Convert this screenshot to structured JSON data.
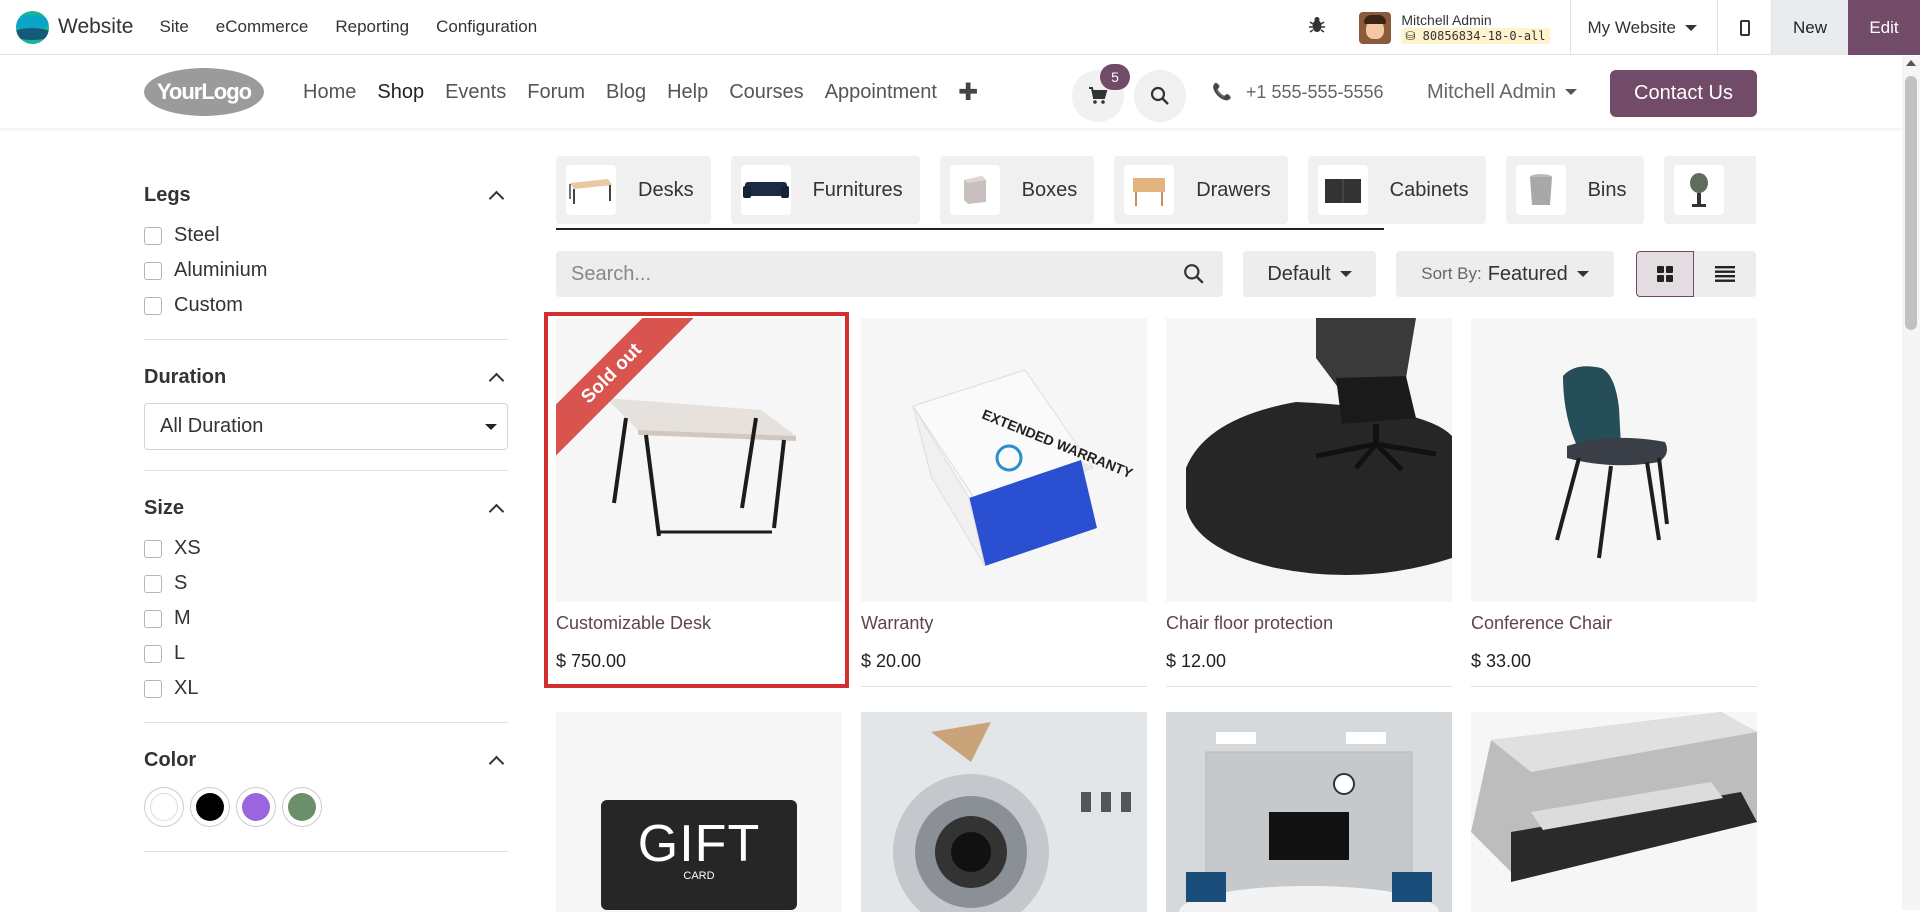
{
  "admin_bar": {
    "brand": "Website",
    "menu": [
      "Site",
      "eCommerce",
      "Reporting",
      "Configuration"
    ],
    "user_name": "Mitchell Admin",
    "db_name": "80856834-18-0-all",
    "my_website": "My Website",
    "new_label": "New",
    "edit_label": "Edit"
  },
  "header": {
    "logo_text": "YourLogo",
    "nav": [
      "Home",
      "Shop",
      "Events",
      "Forum",
      "Blog",
      "Help",
      "Courses",
      "Appointment"
    ],
    "active_nav": "Shop",
    "cart_count": "5",
    "phone": "+1 555-555-5556",
    "user": "Mitchell Admin",
    "contact_label": "Contact Us"
  },
  "filters": {
    "legs": {
      "title": "Legs",
      "options": [
        "Steel",
        "Aluminium",
        "Custom"
      ]
    },
    "duration": {
      "title": "Duration",
      "selected": "All Duration"
    },
    "size": {
      "title": "Size",
      "options": [
        "XS",
        "S",
        "M",
        "L",
        "XL"
      ]
    },
    "color": {
      "title": "Color",
      "swatches": [
        "#ffffff",
        "#000000",
        "#9966dd",
        "#6a8f6a"
      ]
    }
  },
  "categories": [
    "Desks",
    "Furnitures",
    "Boxes",
    "Drawers",
    "Cabinets",
    "Bins"
  ],
  "toolbar": {
    "search_placeholder": "Search...",
    "pricelist": "Default",
    "sort_label": "Sort By:",
    "sort_value": "Featured"
  },
  "products": [
    {
      "name": "Customizable Desk",
      "price": "$ 750.00",
      "ribbon": "Sold out"
    },
    {
      "name": "Warranty",
      "price": "$ 20.00"
    },
    {
      "name": "Chair floor protection",
      "price": "$ 12.00"
    },
    {
      "name": "Conference Chair",
      "price": "$ 33.00"
    }
  ],
  "gift_card": {
    "big": "GIFT",
    "small": "CARD"
  },
  "warranty_box_text": "EXTENDED WARRANTY",
  "colors": {
    "accent": "#714b67",
    "ribbon": "#d9534f",
    "highlight": "#d32f2f"
  }
}
